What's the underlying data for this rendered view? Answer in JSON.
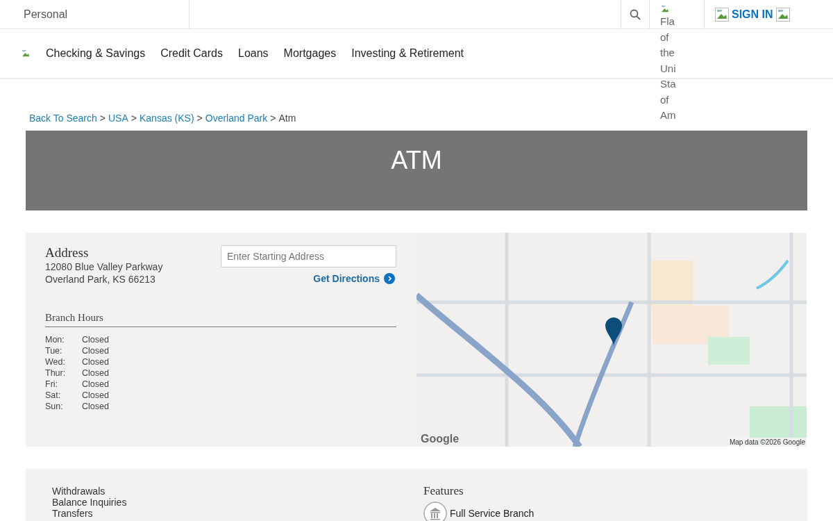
{
  "top_bar": {
    "segment": "Personal",
    "flag_alt_lines": [
      "Fla",
      "of",
      "the",
      "Uni",
      "Sta",
      "of",
      "Am"
    ],
    "sign_in": "SIGN IN"
  },
  "nav": {
    "items": [
      "Checking & Savings",
      "Credit Cards",
      "Loans",
      "Mortgages",
      "Investing & Retirement"
    ]
  },
  "breadcrumb": [
    {
      "label": "Back To Search",
      "kind": "link"
    },
    {
      "label": "USA",
      "kind": "link"
    },
    {
      "label": "Kansas (KS)",
      "kind": "link"
    },
    {
      "label": "Overland Park",
      "kind": "link"
    },
    {
      "label": "Atm",
      "kind": "current"
    }
  ],
  "breadcrumb_separator": ">",
  "banner": {
    "title": "ATM"
  },
  "location": {
    "address_heading": "Address",
    "address_lines": [
      "12080 Blue Valley Parkway",
      "Overland Park, KS 66213"
    ],
    "directions": {
      "placeholder": "Enter Starting Address",
      "button": "Get Directions"
    },
    "hours_heading": "Branch Hours",
    "hours": [
      {
        "day": "Mon:",
        "time": "Closed"
      },
      {
        "day": "Tue:",
        "time": "Closed"
      },
      {
        "day": "Wed:",
        "time": "Closed"
      },
      {
        "day": "Thur:",
        "time": "Closed"
      },
      {
        "day": "Fri:",
        "time": "Closed"
      },
      {
        "day": "Sat:",
        "time": "Closed"
      },
      {
        "day": "Sun:",
        "time": "Closed"
      }
    ]
  },
  "map": {
    "logo": "Google",
    "attribution": "Map data ©2026 Google"
  },
  "services": {
    "items": [
      "Withdrawals",
      "Balance Inquiries",
      "Transfers"
    ],
    "features_heading": "Features",
    "features": [
      "Full Service Branch"
    ]
  }
}
